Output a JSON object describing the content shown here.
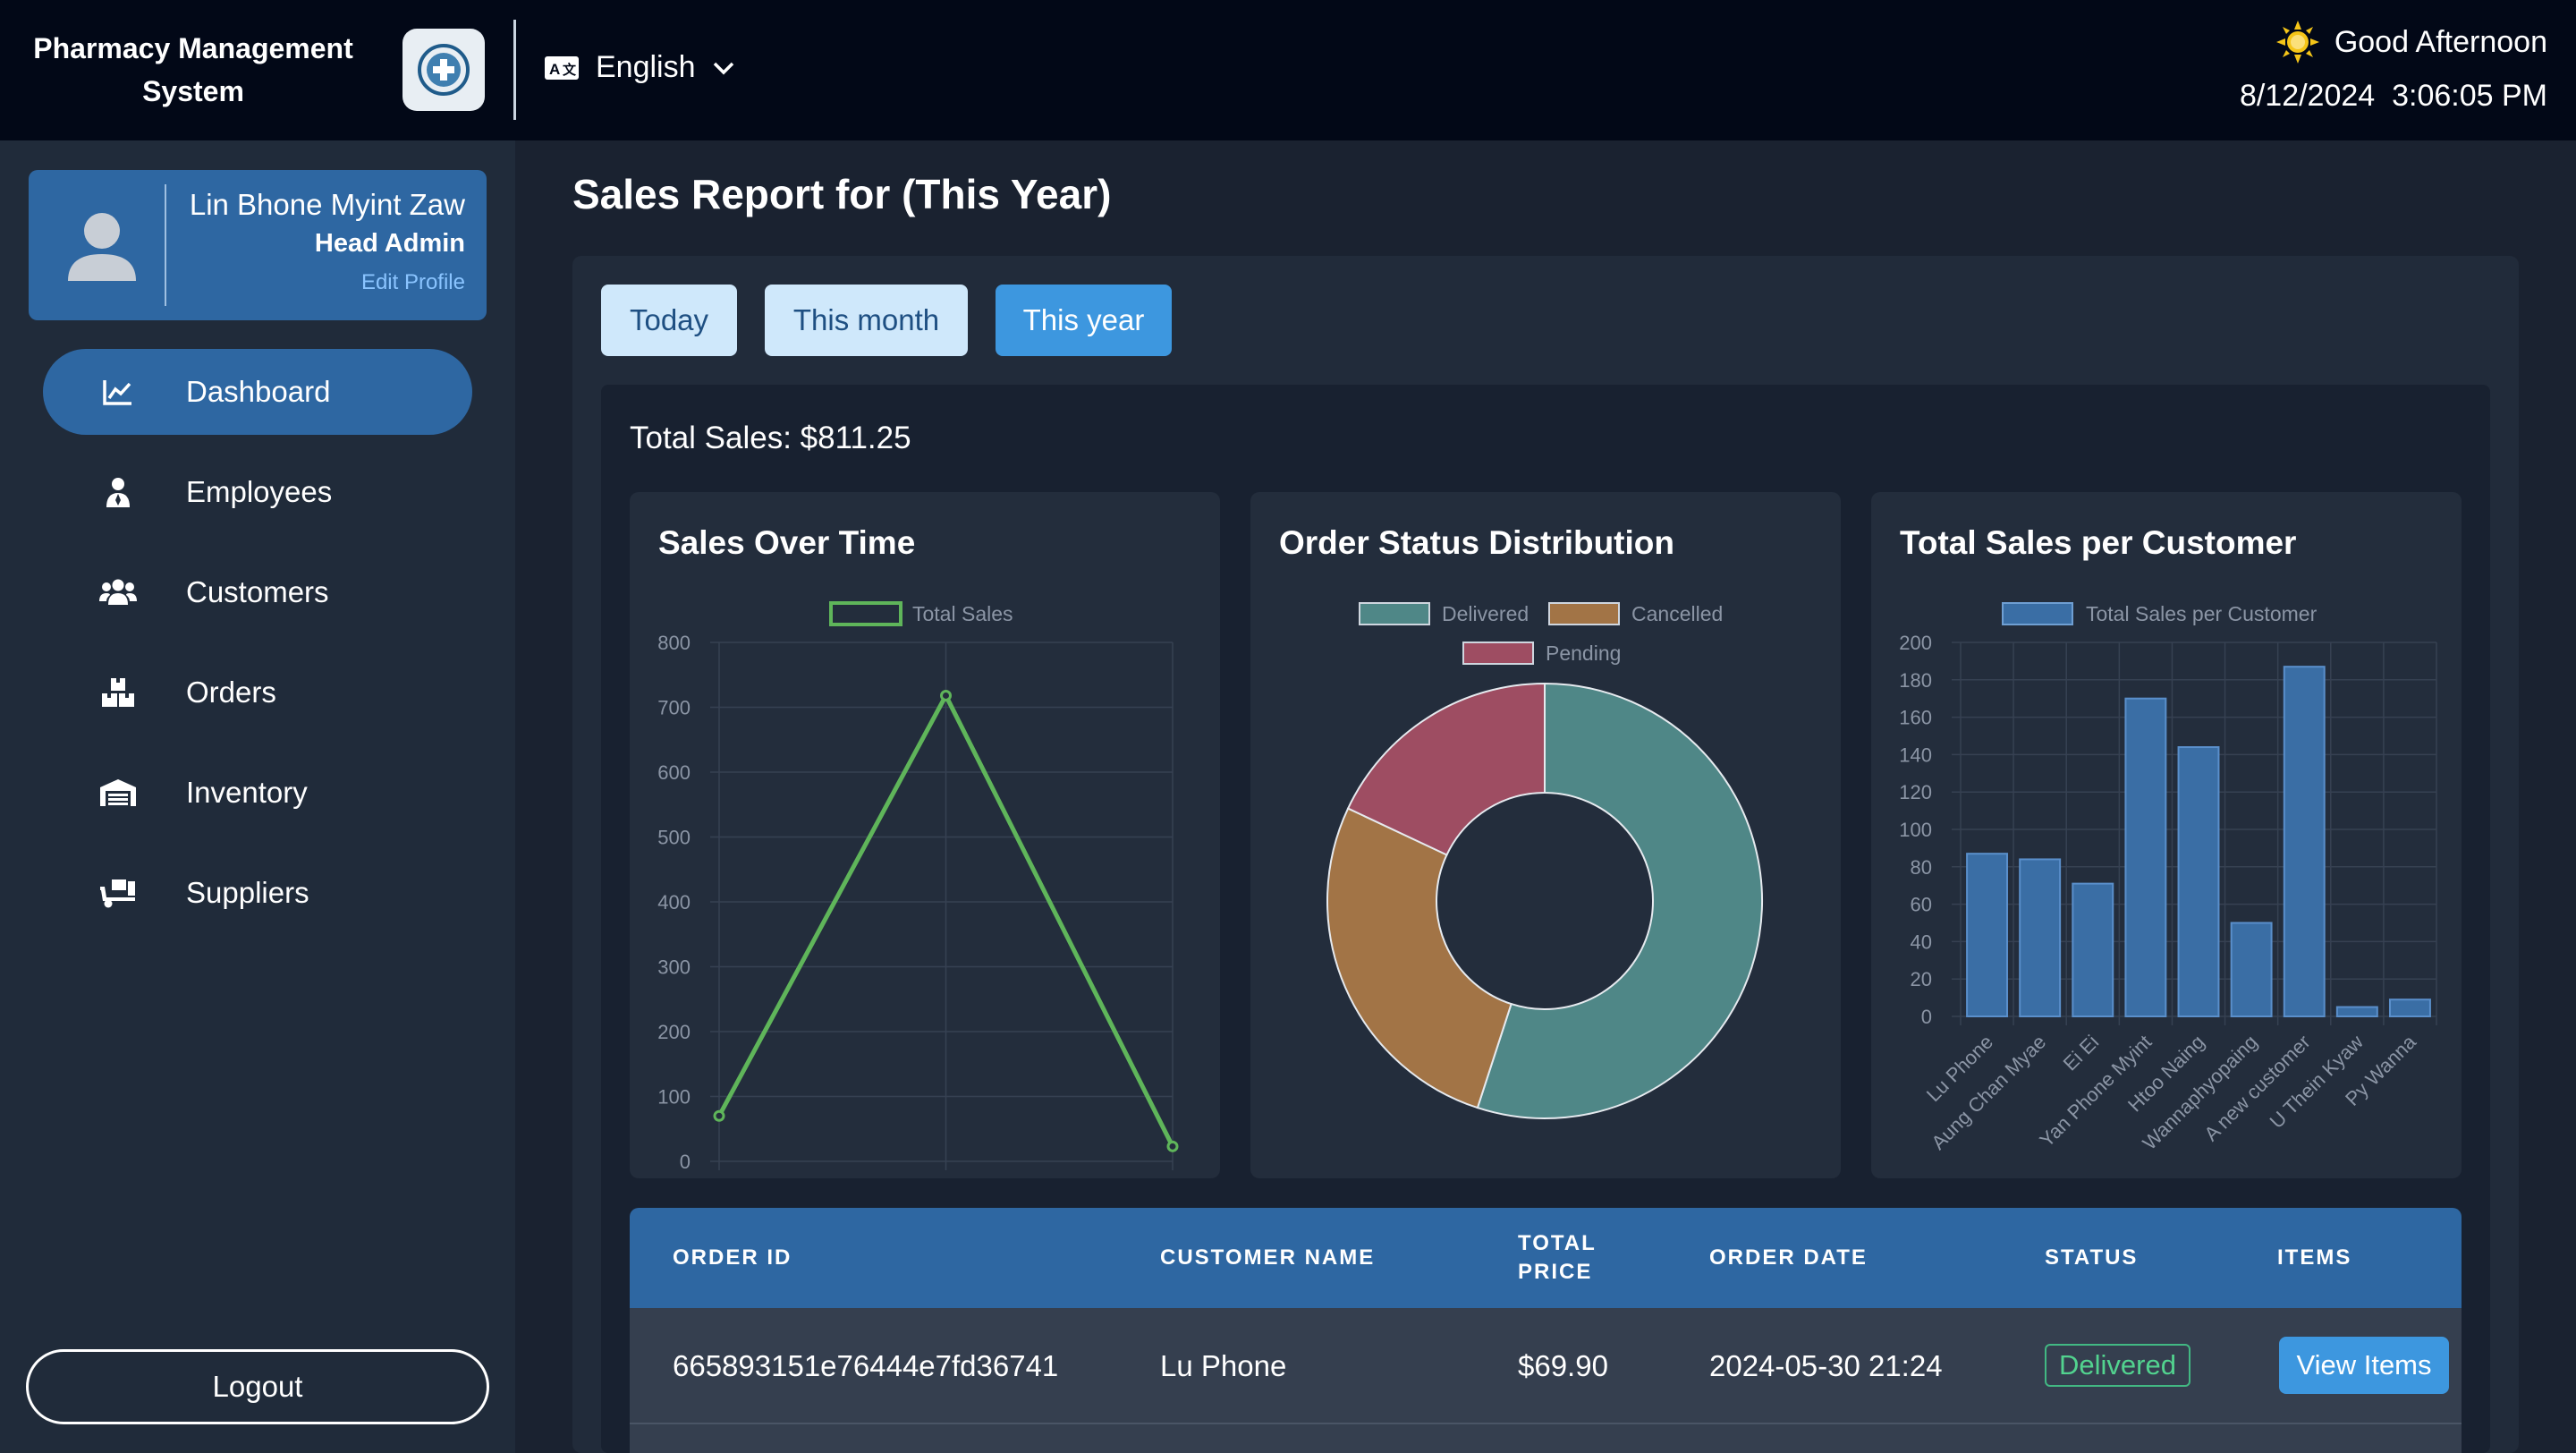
{
  "header": {
    "app_title_line1": "Pharmacy Management",
    "app_title_line2": "System",
    "language": "English",
    "greeting": "Good Afternoon",
    "date": "8/12/2024",
    "time": "3:06:05 PM"
  },
  "profile": {
    "name": "Lin Bhone Myint Zaw",
    "role": "Head Admin",
    "edit_label": "Edit Profile"
  },
  "sidebar": {
    "items": [
      {
        "label": "Dashboard",
        "icon": "chart-line-icon",
        "active": true
      },
      {
        "label": "Employees",
        "icon": "user-tie-icon"
      },
      {
        "label": "Customers",
        "icon": "users-icon"
      },
      {
        "label": "Orders",
        "icon": "boxes-icon"
      },
      {
        "label": "Inventory",
        "icon": "warehouse-icon"
      },
      {
        "label": "Suppliers",
        "icon": "truck-icon"
      }
    ],
    "logout_label": "Logout"
  },
  "report": {
    "title": "Sales Report for (This Year)",
    "filters": [
      "Today",
      "This month",
      "This year"
    ],
    "active_filter": "This year",
    "total_sales": "Total Sales: $811.25"
  },
  "colors": {
    "accent": "#2e67a2",
    "button_active": "#3d97df",
    "line": "#5fb55a",
    "delivered": "#4f8787",
    "cancelled": "#a27446",
    "pending": "#9e4d62",
    "bar": "#3a6ea5"
  },
  "chart_data": [
    {
      "type": "line",
      "title": "Sales Over Time",
      "series": [
        {
          "name": "Total Sales",
          "values": [
            70,
            718,
            23
          ]
        }
      ],
      "x": [
        "",
        "",
        ""
      ],
      "ylim": [
        0,
        800
      ],
      "yticks": [
        "0",
        "100",
        "200",
        "300",
        "400",
        "500",
        "600",
        "700",
        "800"
      ],
      "legend": "top",
      "grid": true
    },
    {
      "type": "pie",
      "title": "Order Status Distribution",
      "categories": [
        "Delivered",
        "Cancelled",
        "Pending"
      ],
      "values": [
        55,
        27,
        18
      ],
      "legend": "top"
    },
    {
      "type": "bar",
      "title": "Total Sales per Customer",
      "categories": [
        "Lu Phone",
        "Aung Chan Myae",
        "Ei Ei",
        "Yan Phone Myint",
        "Htoo Naing",
        "Wannaphyopaing",
        "A new customer",
        "U Thein Kyaw",
        "Py Wanna"
      ],
      "series": [
        {
          "name": "Total Sales per Customer",
          "values": [
            87,
            84,
            71,
            170,
            144,
            50,
            187,
            5,
            9
          ]
        }
      ],
      "ylim": [
        0,
        200
      ],
      "yticks": [
        "0",
        "20",
        "40",
        "60",
        "80",
        "100",
        "120",
        "140",
        "160",
        "180",
        "200"
      ],
      "legend": "top",
      "grid": true
    }
  ],
  "table": {
    "headers": {
      "order_id": "ORDER ID",
      "customer_name": "CUSTOMER NAME",
      "total_price_1": "TOTAL",
      "total_price_2": "PRICE",
      "order_date": "ORDER DATE",
      "status": "STATUS",
      "items": "ITEMS"
    },
    "rows": [
      {
        "order_id": "665893151e76444e7fd36741",
        "customer_name": "Lu Phone",
        "total_price": "$69.90",
        "order_date": "2024-05-30 21:24",
        "status": "Delivered",
        "items_label": "View Items"
      }
    ]
  }
}
